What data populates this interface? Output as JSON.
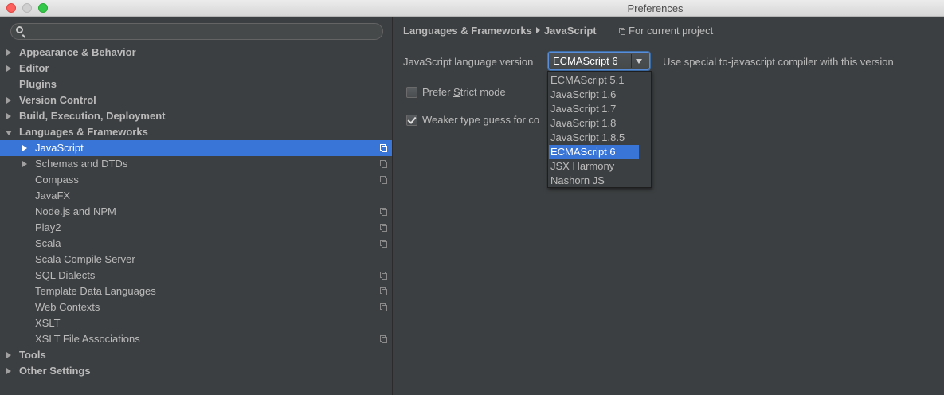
{
  "window": {
    "title": "Preferences"
  },
  "search": {
    "value": "",
    "placeholder": ""
  },
  "tree": [
    {
      "label": "Appearance & Behavior",
      "level": 0,
      "bold": true,
      "arrow": "right",
      "project": false,
      "selected": false
    },
    {
      "label": "Editor",
      "level": 0,
      "bold": true,
      "arrow": "right",
      "project": false,
      "selected": false
    },
    {
      "label": "Plugins",
      "level": 0,
      "bold": true,
      "arrow": "none",
      "project": false,
      "selected": false
    },
    {
      "label": "Version Control",
      "level": 0,
      "bold": true,
      "arrow": "right",
      "project": false,
      "selected": false
    },
    {
      "label": "Build, Execution, Deployment",
      "level": 0,
      "bold": true,
      "arrow": "right",
      "project": false,
      "selected": false
    },
    {
      "label": "Languages & Frameworks",
      "level": 0,
      "bold": true,
      "arrow": "down",
      "project": false,
      "selected": false
    },
    {
      "label": "JavaScript",
      "level": 1,
      "bold": false,
      "arrow": "right",
      "project": true,
      "selected": true
    },
    {
      "label": "Schemas and DTDs",
      "level": 1,
      "bold": false,
      "arrow": "right",
      "project": true,
      "selected": false
    },
    {
      "label": "Compass",
      "level": 1,
      "bold": false,
      "arrow": "none",
      "project": true,
      "selected": false
    },
    {
      "label": "JavaFX",
      "level": 1,
      "bold": false,
      "arrow": "none",
      "project": false,
      "selected": false
    },
    {
      "label": "Node.js and NPM",
      "level": 1,
      "bold": false,
      "arrow": "none",
      "project": true,
      "selected": false
    },
    {
      "label": "Play2",
      "level": 1,
      "bold": false,
      "arrow": "none",
      "project": true,
      "selected": false
    },
    {
      "label": "Scala",
      "level": 1,
      "bold": false,
      "arrow": "none",
      "project": true,
      "selected": false
    },
    {
      "label": "Scala Compile Server",
      "level": 1,
      "bold": false,
      "arrow": "none",
      "project": false,
      "selected": false
    },
    {
      "label": "SQL Dialects",
      "level": 1,
      "bold": false,
      "arrow": "none",
      "project": true,
      "selected": false
    },
    {
      "label": "Template Data Languages",
      "level": 1,
      "bold": false,
      "arrow": "none",
      "project": true,
      "selected": false
    },
    {
      "label": "Web Contexts",
      "level": 1,
      "bold": false,
      "arrow": "none",
      "project": true,
      "selected": false
    },
    {
      "label": "XSLT",
      "level": 1,
      "bold": false,
      "arrow": "none",
      "project": false,
      "selected": false
    },
    {
      "label": "XSLT File Associations",
      "level": 1,
      "bold": false,
      "arrow": "none",
      "project": true,
      "selected": false
    },
    {
      "label": "Tools",
      "level": 0,
      "bold": true,
      "arrow": "right",
      "project": false,
      "selected": false
    },
    {
      "label": "Other Settings",
      "level": 0,
      "bold": true,
      "arrow": "right",
      "project": false,
      "selected": false
    }
  ],
  "breadcrumb": {
    "parent": "Languages & Frameworks",
    "current": "JavaScript"
  },
  "scope": {
    "label": "For current project"
  },
  "settings": {
    "language_label": "JavaScript language version",
    "language_value": "ECMAScript 6",
    "compiler_note": "Use special to-javascript compiler with this version",
    "strict_label_pre": "Prefer ",
    "strict_label_mnemonic": "S",
    "strict_label_post": "trict mode",
    "strict_checked": false,
    "weaker_label": "Weaker type guess for co",
    "weaker_checked": true
  },
  "dropdown": {
    "options": [
      "ECMAScript 5.1",
      "JavaScript 1.6",
      "JavaScript 1.7",
      "JavaScript 1.8",
      "JavaScript 1.8.5",
      "ECMAScript 6",
      "JSX Harmony",
      "Nashorn JS"
    ],
    "selected_index": 5
  },
  "colors": {
    "selection": "#3875d7",
    "background": "#3c3f41"
  }
}
